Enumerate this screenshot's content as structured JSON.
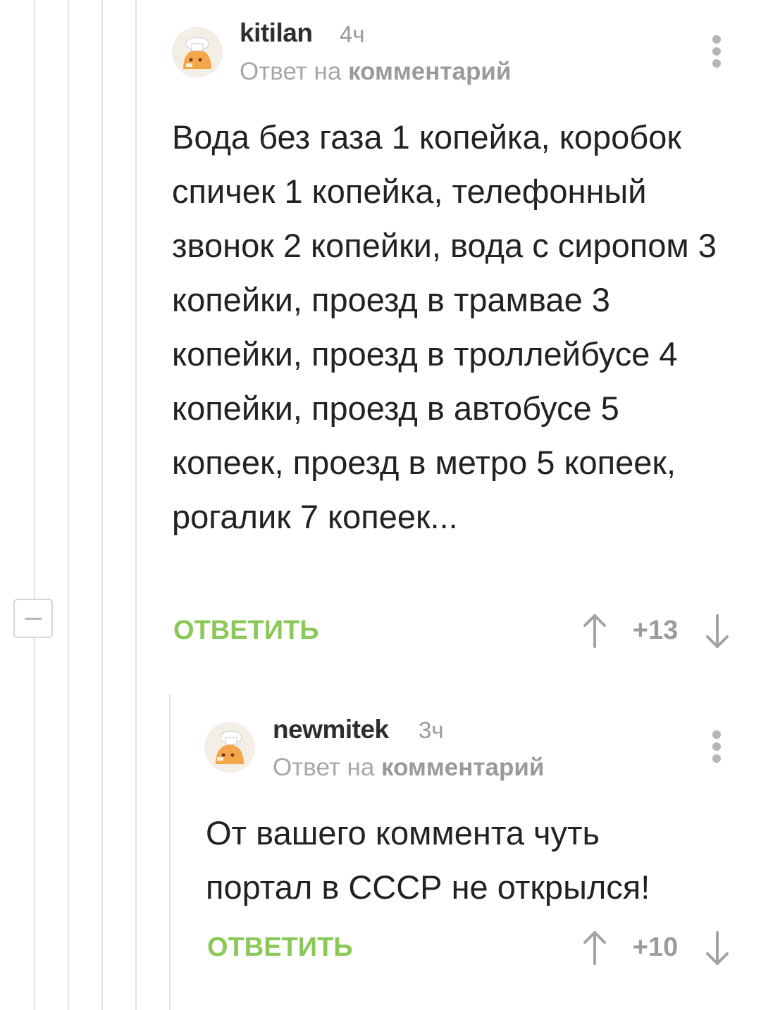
{
  "comments": [
    {
      "username": "kitilan",
      "time": "4ч",
      "reply_prefix": "Ответ на",
      "reply_link": "комментарий",
      "text": "Вода без газа 1 копейка, коробок спичек 1 копейка, телефонный звонок 2 копейки, вода с сиропом 3 копейки, проезд в трамвае 3 копейки, проезд в троллейбусе 4 копейки, проезд в автобусе 5 копеек, проезд в метро 5 копеек, рогалик 7 копеек...",
      "reply_label": "ОТВЕТИТЬ",
      "score": "+13"
    },
    {
      "username": "newmitek",
      "time": "3ч",
      "reply_prefix": "Ответ на",
      "reply_link": "комментарий",
      "text": "От вашего коммента чуть портал в СССР не открылся!",
      "reply_label": "ОТВЕТИТЬ",
      "score": "+10"
    }
  ],
  "colors": {
    "reply_button": "#8ac858",
    "meta_text": "#a8a8a8",
    "thread_line": "#e4e4e4"
  },
  "icons": {
    "collapse": "minus-icon",
    "more": "vertical-dots-icon",
    "upvote": "arrow-up-icon",
    "downvote": "arrow-down-icon",
    "avatar": "default-avatar-icon"
  }
}
